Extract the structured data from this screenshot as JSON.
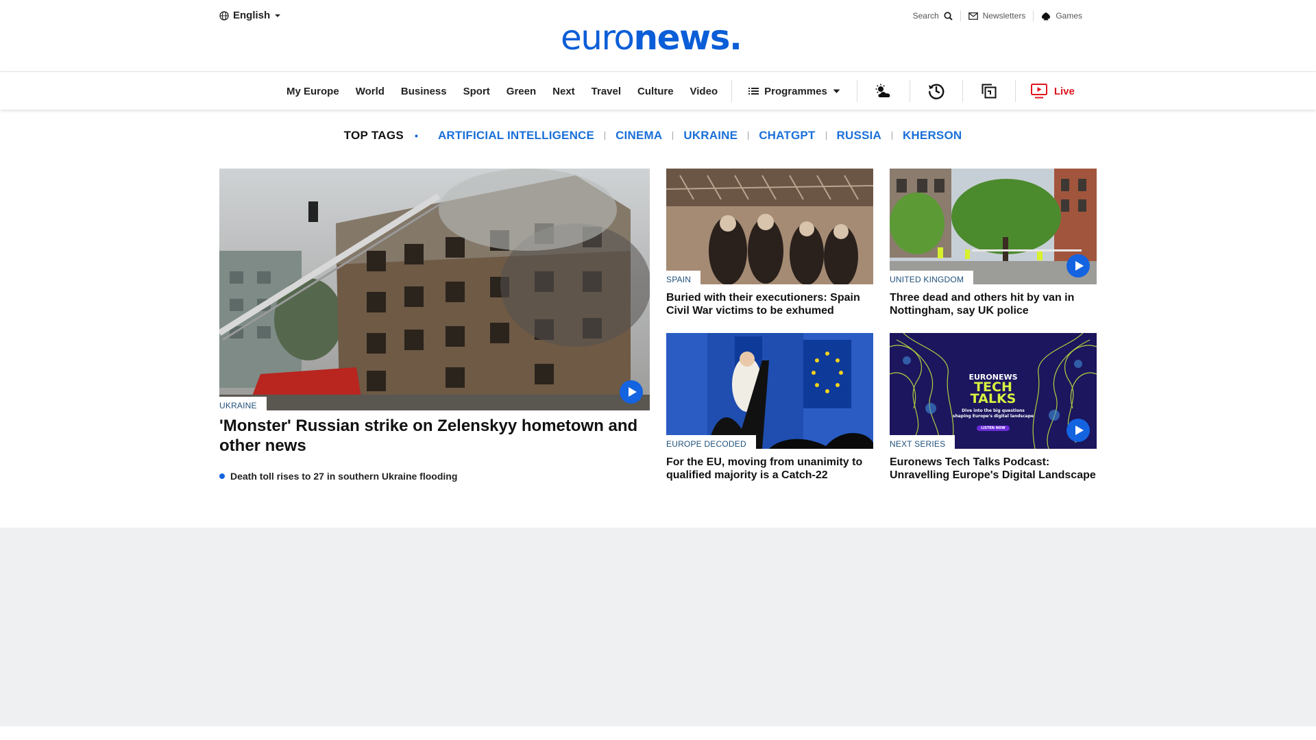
{
  "header": {
    "language": "English",
    "logo_light": "euro",
    "logo_bold": "news",
    "logo_dot": ".",
    "search_label": "Search",
    "newsletters_label": "Newsletters",
    "games_label": "Games"
  },
  "nav": {
    "items": [
      "My Europe",
      "World",
      "Business",
      "Sport",
      "Green",
      "Next",
      "Travel",
      "Culture",
      "Video"
    ],
    "programmes_label": "Programmes",
    "live_label": "Live"
  },
  "top_tags": {
    "label": "TOP TAGS",
    "bullet": "•",
    "tags": [
      "ARTIFICIAL INTELLIGENCE",
      "CINEMA",
      "UKRAINE",
      "CHATGPT",
      "RUSSIA",
      "KHERSON"
    ]
  },
  "stories": {
    "main": {
      "kicker": "UKRAINE",
      "headline": "'Monster' Russian strike on Zelenskyy hometown and other news",
      "related": "Death toll rises to 27 in southern Ukraine flooding"
    },
    "spain": {
      "kicker": "SPAIN",
      "headline": "Buried with their executioners: Spain Civil War victims to be exhumed"
    },
    "uk": {
      "kicker": "UNITED KINGDOM",
      "headline": "Three dead and others hit by van in Nottingham, say UK police"
    },
    "eu": {
      "kicker": "EUROPE DECODED",
      "headline": "For the EU, moving from unanimity to qualified majority is a Catch-22"
    },
    "tech": {
      "kicker": "NEXT SERIES",
      "headline": "Euronews Tech Talks Podcast: Unravelling Europe's Digital Landscape",
      "image_title_1": "EURONEWS",
      "image_title_2": "TECH",
      "image_title_3": "TALKS",
      "image_subtitle": "Dive into the big questions shaping Europe's digital landscape",
      "image_button": "LISTEN NOW"
    }
  },
  "colors": {
    "brand": "#0b5ed7",
    "tag_link": "#1a6fd8",
    "live": "#e0141e",
    "play": "#1463e0",
    "grey_band": "#eef0f2"
  },
  "icons": [
    "globe-icon",
    "caret-down-icon",
    "search-icon",
    "mail-icon",
    "games-icon",
    "menu-icon",
    "weather-icon",
    "history-icon",
    "copy-icon",
    "live-tv-icon",
    "play-icon"
  ]
}
